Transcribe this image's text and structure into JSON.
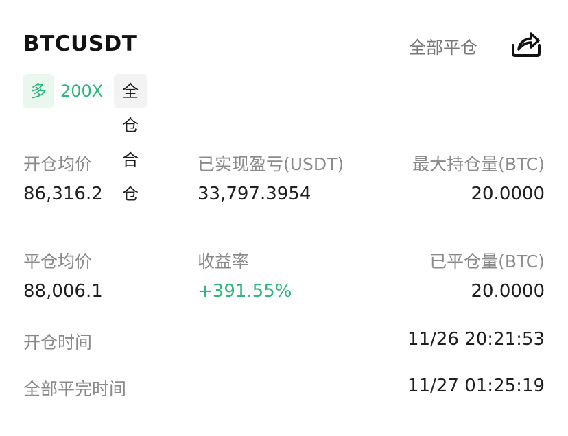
{
  "header": {
    "symbol": "BTCUSDT",
    "close_all_label": "全部平仓",
    "share_icon": "share-icon"
  },
  "tags": {
    "direction": "多",
    "leverage": "200X",
    "margin_mode": "全仓 合仓"
  },
  "stats": {
    "open_avg_price_label": "开仓均价",
    "open_avg_price": "86,316.2",
    "realized_pnl_label": "已实现盈亏(USDT)",
    "realized_pnl": "33,797.3954",
    "max_position_label": "最大持仓量(BTC)",
    "max_position": "20.0000",
    "close_avg_price_label": "平仓均价",
    "close_avg_price": "88,006.1",
    "roi_label": "收益率",
    "roi": "+391.55%",
    "closed_qty_label": "已平仓量(BTC)",
    "closed_qty": "20.0000",
    "open_time_label": "开仓时间",
    "open_time": "11/26 20:21:53",
    "close_time_label": "全部平完时间",
    "close_time": "11/27 01:25:19"
  },
  "colors": {
    "profit_green": "#2eb67d",
    "label_gray": "#8a8a8a",
    "text_dark": "#1f1f1f"
  }
}
